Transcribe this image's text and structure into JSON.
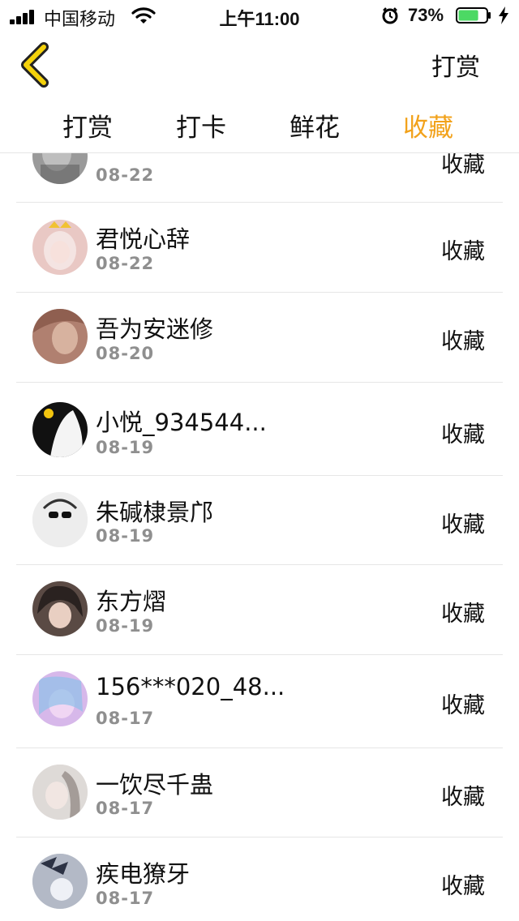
{
  "status_bar": {
    "carrier": "中国移动",
    "time": "上午11:00",
    "battery_percent": "73%",
    "battery_level": 0.73,
    "battery_color": "#4cd964"
  },
  "nav": {
    "back_icon": "chevron-left-icon",
    "back_color": "#f5d20b",
    "right_label": "打赏"
  },
  "tabs": {
    "active_color": "#f2a21b",
    "items": [
      {
        "label": "打赏"
      },
      {
        "label": "打卡"
      },
      {
        "label": "鲜花"
      },
      {
        "label": "收藏"
      }
    ],
    "active_index": 3
  },
  "list": {
    "items": [
      {
        "name": "",
        "date": "08-22",
        "action": "收藏",
        "avatar_color": "#9a9a9a"
      },
      {
        "name": "君悦心辞",
        "date": "08-22",
        "action": "收藏",
        "avatar_color": "#e9c8c4"
      },
      {
        "name": "吾为安迷修",
        "date": "08-20",
        "action": "收藏",
        "avatar_color": "#b08070"
      },
      {
        "name": "小悦_934544...",
        "date": "08-19",
        "action": "收藏",
        "avatar_color": "#111111"
      },
      {
        "name": "朱碱棣景邝",
        "date": "08-19",
        "action": "收藏",
        "avatar_color": "#d8d8d8"
      },
      {
        "name": "东方熠",
        "date": "08-19",
        "action": "收藏",
        "avatar_color": "#5a4a44"
      },
      {
        "name": "156***020_48...",
        "date": "08-17",
        "action": "收藏",
        "avatar_color": "#d7b8ea"
      },
      {
        "name": "一饮尽千蛊",
        "date": "08-17",
        "action": "收藏",
        "avatar_color": "#c9c1bd"
      },
      {
        "name": "疾电獠牙",
        "date": "08-17",
        "action": "收藏",
        "avatar_color": "#8a94a8"
      }
    ]
  }
}
